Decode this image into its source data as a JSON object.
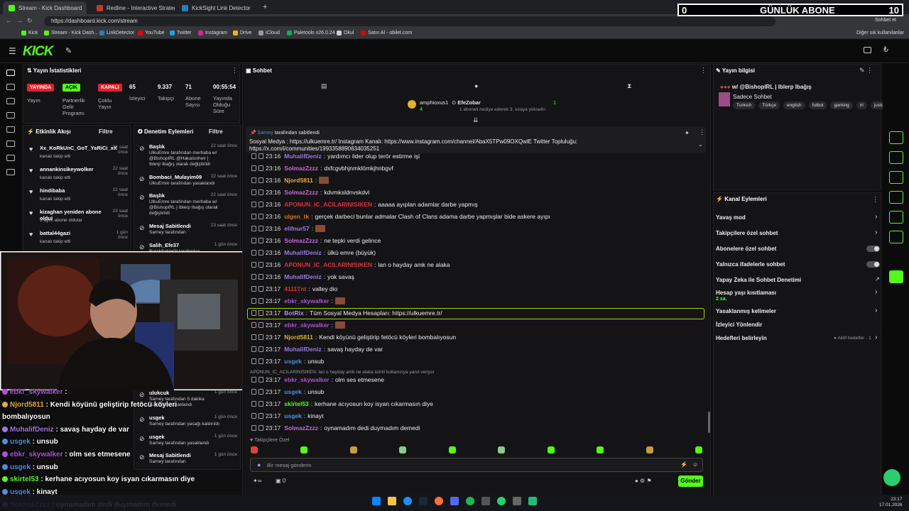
{
  "browser": {
    "tabs": [
      {
        "title": "Stream - Kick Dashboard",
        "color": "#53fc18"
      },
      {
        "title": "Redline - Interactive Strategic Map",
        "color": "#c0392b"
      },
      {
        "title": "KickSight Link Detector",
        "color": "#2980b9"
      }
    ],
    "url": "https://dashboard.kick.com/stream",
    "profile_label": "Sohbet et",
    "bookmarks": [
      "Kick",
      "Stream - Kick Dash...",
      "LinkDetector",
      "YouTube",
      "Twitter",
      "Instagram",
      "Drive",
      "iCloud",
      "Paletools v26.0.24",
      "Okul",
      "Satın Al - obilet.com"
    ],
    "bookmark_other": "Diğer yer işaretleri",
    "bookmark_other_users": "Diğer sık kullanılanlar"
  },
  "sub_widget": {
    "count": "0",
    "label": "GÜNLÜK ABONE",
    "goal": "10"
  },
  "kick": {
    "logo": "KICK",
    "beta": "BETA"
  },
  "stats": {
    "title": "Yayın İstatistikleri",
    "status": [
      {
        "badge": "YAYINDA",
        "label": "Yayın",
        "color": "#e0212e"
      },
      {
        "badge": "AÇIK",
        "label": "Partnerlik Gelir Programı",
        "color": "#53fc18"
      },
      {
        "badge": "KAPALI",
        "label": "Çoklu Yayın",
        "color": "#e0212e"
      }
    ],
    "items": [
      {
        "value": "65",
        "label": "İzleyici"
      },
      {
        "value": "9.337",
        "label": "Takipçi"
      },
      {
        "value": "71",
        "label": "Abone Sayısı"
      },
      {
        "value": "00:55:54",
        "label": "Yayında Olduğu Süre"
      }
    ]
  },
  "activity": {
    "title": "Etkinlik Akışı",
    "filter": "Filtre",
    "items": [
      {
        "name": "Xx_KoRkUnC_GoT_YaRiCi_xX",
        "desc": "kanalı takip etti",
        "time": "22 saat önce"
      },
      {
        "name": "annankinsikeywolker",
        "desc": "kanalı takip etti",
        "time": "22 saat önce"
      },
      {
        "name": "hindibaba",
        "desc": "kanalı takip etti",
        "time": "22 saat önce"
      },
      {
        "name": "kizaghan yeniden abone oldu!",
        "desc": "3 aylık abone oldular",
        "time": "23 saat önce"
      },
      {
        "name": "battal44gazi",
        "desc": "kanalı takip etti",
        "time": "1 gün önce"
      },
      {
        "name": "Subutay0 yeniden abone",
        "desc": "",
        "time": ""
      }
    ]
  },
  "mod": {
    "title": "Denetim Eylemleri",
    "filter": "Filtre",
    "items": [
      {
        "name": "Başlık",
        "desc": "UlkuEmre tarafından merhaba w/ @BishopIRL @Hakatonheir | Iblerp Ibağış olarak değiştirildi",
        "time": "22 saat önce"
      },
      {
        "name": "Bombaci_Mulayim09",
        "desc": "UlkuEmre tarafından yasaklandı",
        "time": "22 saat önce"
      },
      {
        "name": "Başlık",
        "desc": "UlkuEmre tarafından merhaba w/ @BishopIRL | Iblerp Ibağış olarak değiştirildi",
        "time": "22 saat önce"
      },
      {
        "name": "Mesaj Sabitlendi",
        "desc": "Sarney tarafından",
        "time": "23 saat önce"
      },
      {
        "name": "Salih_Efe37",
        "desc": "BurakSakinO! tarafından yasaklandı",
        "time": "1 gün önce"
      },
      {
        "name": "ulukcuk",
        "desc": "Sarney tarafından 5 dakika süreliğine yasaklandı",
        "time": "1 gün önce"
      },
      {
        "name": "usgek",
        "desc": "Sarney tarafından yasağı kaldırıldı",
        "time": "1 gün önce"
      },
      {
        "name": "usgek",
        "desc": "Sarney tarafından yasaklandı",
        "time": "1 gün önce"
      },
      {
        "name": "Mesaj Sabitlendi",
        "desc": "Sarney tarafından",
        "time": "1 gün önce"
      }
    ]
  },
  "chat": {
    "title": "Sohbet",
    "gifter1": {
      "name": "amphioxus1",
      "count": "4"
    },
    "gifter2": {
      "name": "EfeZobar",
      "count": "1",
      "desc": "1 aboneli hediye ederek 3. sıraya yükselin"
    },
    "pinned": {
      "by": "Sarney",
      "by_suffix": "tarafından sabitlendi",
      "text": "Sosyal Medya : https://ulkuemre.tr/ Instagram Kanalı: https://www.instagram.com/channel/AbaX5TPw09OXQwlE Twitter Topluluğu: https://x.com/i/communities/1993358890634035251"
    },
    "messages": [
      {
        "time": "23:16",
        "user": "MuhalifDeniz",
        "color": "#9b7ae0",
        "text": "yardımcı lider olup terör estirme işi"
      },
      {
        "time": "23:16",
        "user": "SolmazZzzz",
        "color": "#c86bd8",
        "text": "dxfcgvbhjnmklömkjhnbgvf"
      },
      {
        "time": "23:16",
        "user": "Njord5811",
        "color": "#e0b030",
        "text": ""
      },
      {
        "time": "23:16",
        "user": "SolmazZzzz",
        "color": "#c86bd8",
        "text": "kdvmksldnvskdvl"
      },
      {
        "time": "23:16",
        "user": "APONUN_IC_ACILARINISIKEN",
        "color": "#e0303a",
        "text": "aaaaa ayıplan adamlar darbe yapmış"
      },
      {
        "time": "23:16",
        "user": "ulgen_tk",
        "color": "#e07020",
        "text": "gerçek darbeci bunlar admalar Clash of Clans adama darbe yapmışlar bide askere ayıpı"
      },
      {
        "time": "23:16",
        "user": "elifnur57",
        "color": "#9b7ae0",
        "text": ""
      },
      {
        "time": "23:16",
        "user": "SolmazZzzz",
        "color": "#c86bd8",
        "text": "ne tepki verdi gelince"
      },
      {
        "time": "23:16",
        "user": "MuhalifDeniz",
        "color": "#9b7ae0",
        "text": "ülkü emre (büyük)"
      },
      {
        "time": "23:16",
        "user": "APONUN_IC_ACILARINISIKEN",
        "color": "#e0303a",
        "text": "lan o hayday amk ne alaka"
      },
      {
        "time": "23:16",
        "user": "MuhalifDeniz",
        "color": "#9b7ae0",
        "text": "yok savaş"
      },
      {
        "time": "23:17",
        "user": "4111Tnt",
        "color": "#e0303a",
        "text": "valley dio"
      },
      {
        "time": "23:17",
        "user": "ebkr_skywalker",
        "color": "#b050d8",
        "text": ""
      },
      {
        "time": "23:17",
        "user": "BotRix",
        "color": "#b58cff",
        "text": "Tüm Sosyal Medya Hesapları: https://ulkuemre.tr/"
      },
      {
        "time": "23:17",
        "user": "ebkr_skywalker",
        "color": "#b050d8",
        "text": ""
      },
      {
        "time": "23:17",
        "user": "Njord5811",
        "color": "#e0b030",
        "text": "Kendi köyünü geliştirip fetöcü köyleri bombalıyosun"
      },
      {
        "time": "23:17",
        "user": "MuhalifDeniz",
        "color": "#9b7ae0",
        "text": "savaş hayday de var"
      },
      {
        "time": "23:17",
        "user": "usgek",
        "color": "#4a8fe0",
        "text": "unsub"
      },
      {
        "time": "23:17",
        "user": "ebkr_skywalker",
        "color": "#b050d8",
        "text": "olm ses etmesene"
      },
      {
        "time": "23:17",
        "user": "usgek",
        "color": "#4a8fe0",
        "text": "unsub"
      },
      {
        "time": "23:17",
        "user": "skirtel53",
        "color": "#53fc18",
        "text": "kerhane acıyosun koy isyan cıkarmasın diye"
      },
      {
        "time": "23:17",
        "user": "usgek",
        "color": "#4a8fe0",
        "text": "kinayt"
      },
      {
        "time": "23:17",
        "user": "SolmazZzzz",
        "color": "#c86bd8",
        "text": "oynamadım dedi duymadım demedi"
      }
    ],
    "reply_note": "APONUN_IC_ACILARINISIKEN: lan o hayday amk ne alaka isimli kullanıcıya yanıt veriyor",
    "followers_only": "Takipçilere Özel",
    "input_placeholder": "Bir mesaj gönderin",
    "send": "Gönder",
    "points": "0"
  },
  "stream_info": {
    "title": "Yayın bilgisi",
    "stream_title": "w/ @BishopIRL | Iblerp Ibağış",
    "category": "Sadece Sohbet",
    "tags": [
      "Turkish",
      "Türkçe",
      "english",
      "futbol",
      "gaming",
      "irl",
      "justchat"
    ]
  },
  "channel_actions": {
    "title": "Kanal Eylemleri",
    "rows": [
      {
        "label": "Yavaş mod",
        "type": "chevron"
      },
      {
        "label": "Takipçilere özel sohbet",
        "type": "chevron"
      },
      {
        "label": "Abonelere özel sohbet",
        "type": "toggle"
      },
      {
        "label": "Yalnızca ifadelerle sohbet",
        "type": "toggle"
      },
      {
        "label": "Yapay Zeka ile Sohbet Denetimi",
        "type": "external"
      },
      {
        "label": "Hesap yaşı kısıtlaması",
        "sub": "2 sa.",
        "type": "chevron"
      },
      {
        "label": "Yasaklanmış kelimeler",
        "type": "chevron"
      },
      {
        "label": "İzleyici Yönlendir",
        "type": "none"
      },
      {
        "label": "Hedefleri belirleyin",
        "note": "Aktif hedefler - 1",
        "type": "chevron"
      }
    ]
  },
  "overlay_chat": [
    {
      "user": "ebkr_skywalker",
      "text": "",
      "color": "#b050d8"
    },
    {
      "user": "Njord5811",
      "text": "Kendi köyünü geliştirip fetöcü köyleri",
      "color": "#e0b030"
    },
    {
      "user": "",
      "text": "bombalıyosun",
      "color": "#fff"
    },
    {
      "user": "MuhalifDeniz",
      "text": "savaş hayday de var",
      "color": "#9b7ae0"
    },
    {
      "user": "usgek",
      "text": "unsub",
      "color": "#4a8fe0"
    },
    {
      "user": "ebkr_skywalker",
      "text": "olm ses etmesene",
      "color": "#b050d8"
    },
    {
      "user": "usgek",
      "text": "unsub",
      "color": "#4a8fe0"
    },
    {
      "user": "skirtel53",
      "text": "kerhane acıyosun koy isyan cıkarmasın diye",
      "color": "#53fc18"
    },
    {
      "user": "usgek",
      "text": "kinayt",
      "color": "#4a8fe0"
    },
    {
      "user": "SolmazZzzz",
      "text": "oynamadım dedi duymadım demedi",
      "color": "#c86bd8"
    }
  ],
  "taskbar": {
    "time": "23:17",
    "date": "17.01.2026"
  }
}
